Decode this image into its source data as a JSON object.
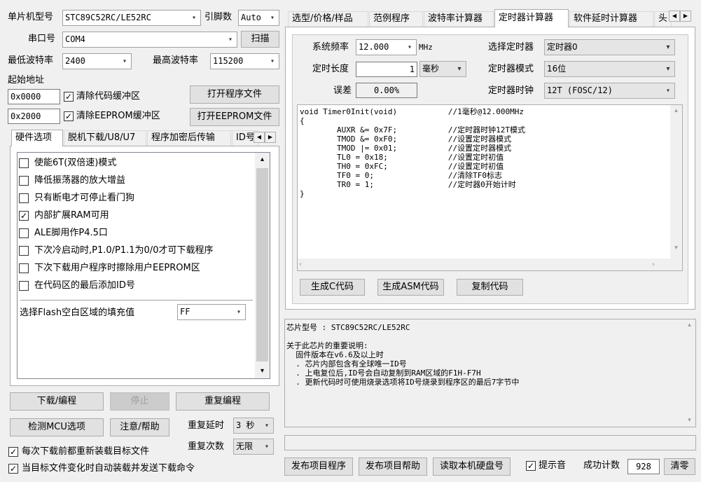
{
  "top": {
    "mcu_label": "单片机型号",
    "mcu_value": "STC89C52RC/LE52RC",
    "pins_label": "引脚数",
    "pins_value": "Auto",
    "port_label": "串口号",
    "port_value": "COM4",
    "scan_button": "扫描",
    "min_baud_label": "最低波特率",
    "min_baud_value": "2400",
    "max_baud_label": "最高波特率",
    "max_baud_value": "115200",
    "start_addr_label": "起始地址",
    "addr1_value": "0x0000",
    "clear_code_label": "清除代码缓冲区",
    "open_program_button": "打开程序文件",
    "addr2_value": "0x2000",
    "clear_eeprom_label": "清除EEPROM缓冲区",
    "open_eeprom_button": "打开EEPROM文件"
  },
  "left_tabs": [
    "硬件选项",
    "脱机下载/U8/U7",
    "程序加密后传输",
    "ID号"
  ],
  "hw_options": [
    {
      "label": "使能6T(双倍速)模式",
      "checked": false
    },
    {
      "label": "降低振荡器的放大增益",
      "checked": false
    },
    {
      "label": "只有断电才可停止看门狗",
      "checked": false
    },
    {
      "label": "内部扩展RAM可用",
      "checked": true
    },
    {
      "label": "ALE脚用作P4.5口",
      "checked": false
    },
    {
      "label": "下次冷启动时,P1.0/P1.1为0/0才可下载程序",
      "checked": false
    },
    {
      "label": "下次下载用户程序时擦除用户EEPROM区",
      "checked": false
    },
    {
      "label": "在代码区的最后添加ID号",
      "checked": false
    }
  ],
  "fill": {
    "label": "选择Flash空白区域的填充值",
    "value": "FF"
  },
  "bottom_left": {
    "download_button": "下载/编程",
    "stop_button": "停止",
    "reprogram_button": "重复编程",
    "detect_button": "检测MCU选项",
    "help_button": "注意/帮助",
    "repeat_delay_label": "重复延时",
    "repeat_delay_value": "3 秒",
    "repeat_count_label": "重复次数",
    "repeat_count_value": "无限",
    "reload_label": "每次下载前都重新装载目标文件",
    "auto_label": "当目标文件变化时自动装载并发送下载命令"
  },
  "right_tabs": [
    "选型/价格/样品",
    "范例程序",
    "波特率计算器",
    "定时器计算器",
    "软件延时计算器",
    "头"
  ],
  "timer": {
    "sysfreq_label": "系统频率",
    "sysfreq_value": "12.000",
    "sysfreq_unit": "MHz",
    "select_timer_label": "选择定时器",
    "select_timer_value": "定时器0",
    "length_label": "定时长度",
    "length_value": "1",
    "length_unit": "毫秒",
    "mode_label": "定时器模式",
    "mode_value": "16位",
    "error_label": "误差",
    "error_value": "0.00%",
    "clock_label": "定时器时钟",
    "clock_value": "12T (FOSC/12)",
    "gen_c_button": "生成C代码",
    "gen_asm_button": "生成ASM代码",
    "copy_button": "复制代码"
  },
  "code_lines": [
    "void Timer0Init(void)\t\t//1毫秒@12.000MHz",
    "{",
    "\tAUXR &= 0x7F;\t\t//定时器时钟12T模式",
    "\tTMOD &= 0xF0;\t\t//设置定时器模式",
    "\tTMOD |= 0x01;\t\t//设置定时器模式",
    "\tTL0 = 0x18;\t\t//设置定时初值",
    "\tTH0 = 0xFC;\t\t//设置定时初值",
    "\tTF0 = 0;\t\t//清除TF0标志",
    "\tTR0 = 1;\t\t//定时器0开始计时",
    "}"
  ],
  "info_lines": [
    "芯片型号 : STC89C52RC/LE52RC",
    "",
    "关于此芯片的重要说明:",
    "  固件版本在v6.6及以上时",
    "  . 芯片内部包含有全球唯一ID号",
    "  . 上电复位后,ID号会自动复制到RAM区域的F1H-F7H",
    "  . 更新代码时可使用烧录选项将ID号烧录到程序区的最后7字节中"
  ],
  "bottom_right": {
    "publish_program_button": "发布项目程序",
    "publish_help_button": "发布项目帮助",
    "read_disk_button": "读取本机硬盘号",
    "sound_label": "提示音",
    "success_label": "成功计数",
    "success_value": "928",
    "clear_button": "清零"
  }
}
